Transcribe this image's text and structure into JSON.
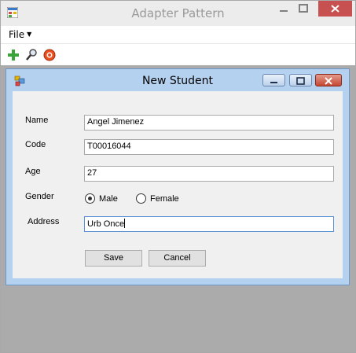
{
  "window": {
    "title": "Adapter Pattern"
  },
  "menu": {
    "file_label": "File"
  },
  "toolbar": {
    "icons": [
      "add-icon",
      "search-icon",
      "delete-icon"
    ]
  },
  "child_window": {
    "title": "New Student"
  },
  "form": {
    "name_label": "Name",
    "name_value": "Angel Jimenez",
    "code_label": "Code",
    "code_value": "T00016044",
    "age_label": "Age",
    "age_value": "27",
    "gender_label": "Gender",
    "gender_options": [
      "Male",
      "Female"
    ],
    "gender_selected": "Male",
    "address_label": "Address",
    "address_value": "Urb Once",
    "save_label": "Save",
    "cancel_label": "Cancel"
  },
  "colors": {
    "close_button": "#c75050",
    "child_frame": "#b4d2f0",
    "mdi_background": "#ababab",
    "focus_border": "#5b8fd6"
  }
}
